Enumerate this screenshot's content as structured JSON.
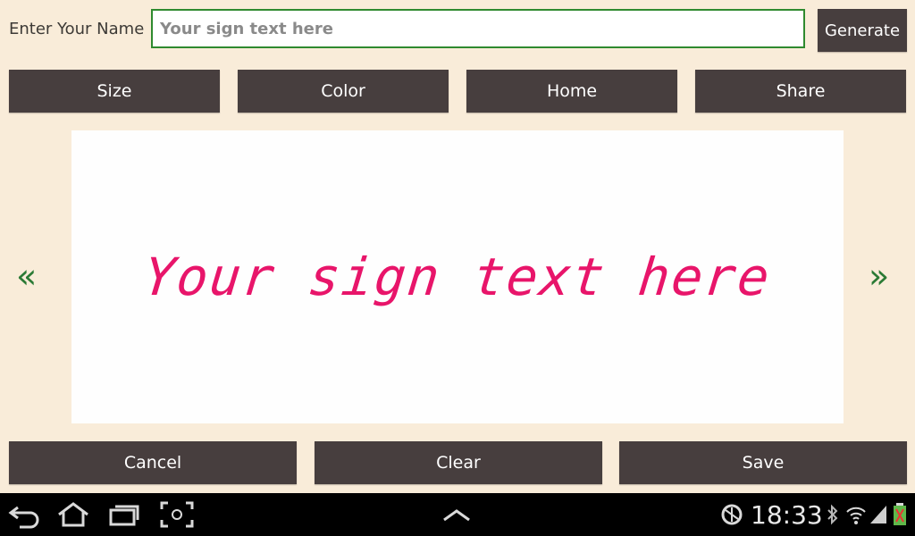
{
  "form": {
    "label": "Enter Your Name",
    "placeholder": "Your sign text here",
    "generate_label": "Generate"
  },
  "toolbar": {
    "size_label": "Size",
    "color_label": "Color",
    "home_label": "Home",
    "share_label": "Share"
  },
  "preview": {
    "sign_text": "Your sign text here",
    "prev_label": "«",
    "next_label": "»",
    "sign_color": "#e8156a"
  },
  "actions": {
    "cancel_label": "Cancel",
    "clear_label": "Clear",
    "save_label": "Save"
  },
  "system_bar": {
    "time": "18:33",
    "icons": [
      "back-icon",
      "home-icon",
      "recent-apps-icon",
      "screenshot-icon",
      "up-chevron-icon",
      "sync-icon",
      "bluetooth-icon",
      "wifi-icon",
      "signal-icon",
      "battery-icon"
    ]
  },
  "colors": {
    "background": "#f9ecd9",
    "button": "#473e3e",
    "input_border": "#2f8a2f",
    "arrows": "#2b7a35"
  }
}
